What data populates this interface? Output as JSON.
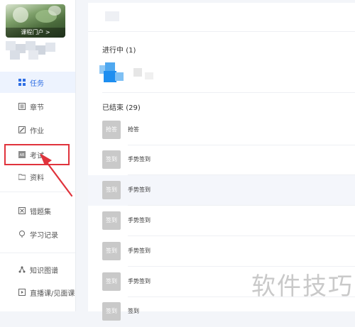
{
  "sidebar": {
    "portal_label": "课程门户 >",
    "items": [
      {
        "label": "任务",
        "icon": "grid-icon",
        "active": true
      },
      {
        "label": "章节",
        "icon": "chapter-icon"
      },
      {
        "label": "作业",
        "icon": "edit-icon"
      },
      {
        "label": "考试",
        "icon": "exam-icon"
      },
      {
        "label": "资料",
        "icon": "folder-icon"
      },
      {
        "label": "错题集",
        "icon": "wrongbook-icon"
      },
      {
        "label": "学习记录",
        "icon": "record-icon"
      },
      {
        "label": "知识图谱",
        "icon": "graph-icon"
      },
      {
        "label": "直播课/见面课",
        "icon": "live-icon"
      }
    ]
  },
  "main": {
    "ongoing": {
      "label": "进行中",
      "count": "(1)"
    },
    "finished": {
      "label": "已结束",
      "count": "(29)"
    },
    "activities": [
      {
        "badge": "抢答",
        "name": "抢答"
      },
      {
        "badge": "签到",
        "name": "手势签到"
      },
      {
        "badge": "签到",
        "name": "手势签到"
      },
      {
        "badge": "签到",
        "name": "手势签到"
      },
      {
        "badge": "签到",
        "name": "手势签到"
      },
      {
        "badge": "签到",
        "name": "手势签到"
      },
      {
        "badge": "签到",
        "name": "签到"
      }
    ]
  },
  "watermark": "软件技巧",
  "colors": {
    "accent": "#2f6fe4",
    "highlight": "#e0333c",
    "badge": "#c9c9c9"
  }
}
